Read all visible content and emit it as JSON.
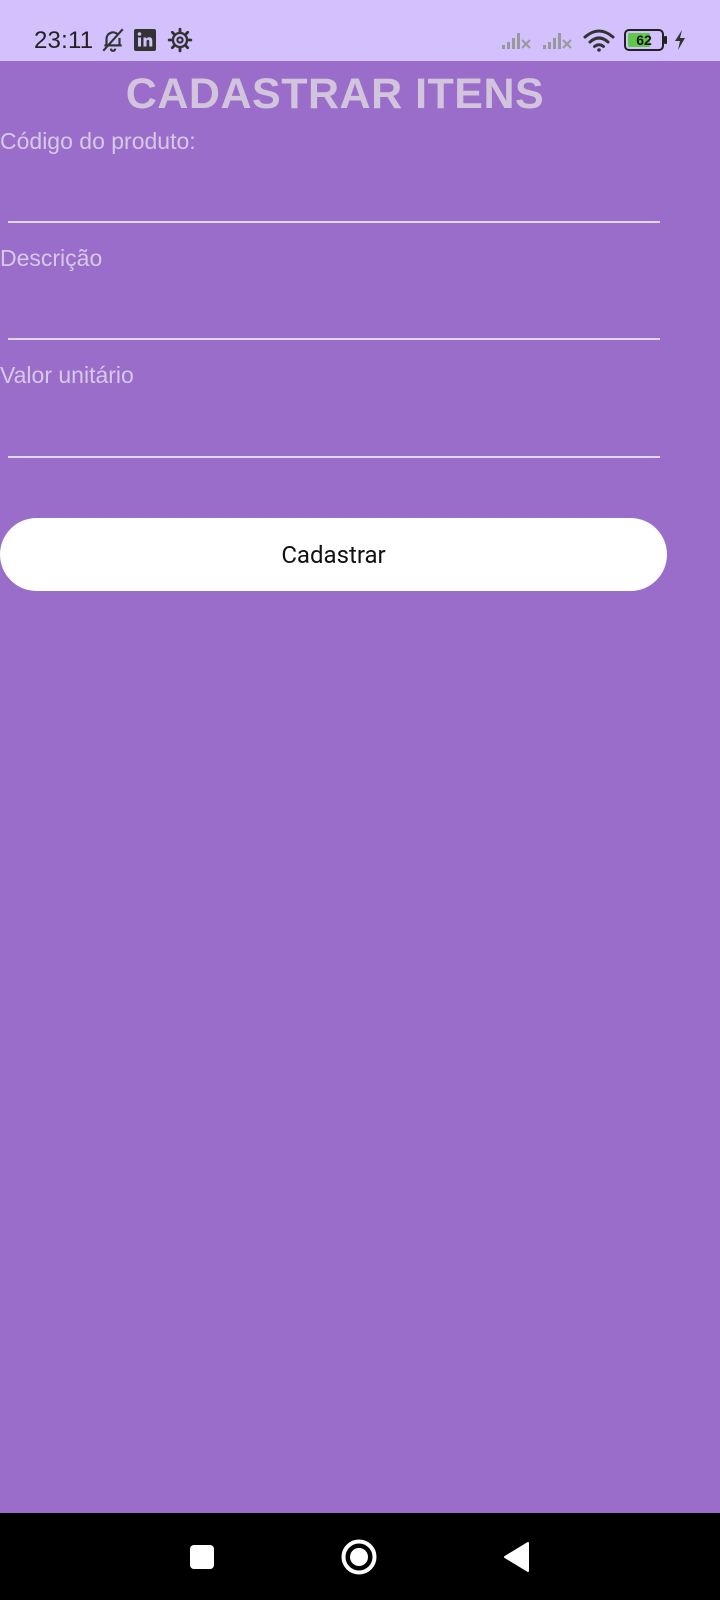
{
  "status_bar": {
    "time": "23:11",
    "battery_level": "62",
    "icons": [
      "notifications-off-icon",
      "linkedin-icon",
      "settings-icon",
      "signal-no-service-icon",
      "signal-no-service-icon",
      "wifi-icon",
      "battery-icon",
      "charging-bolt-icon"
    ]
  },
  "form": {
    "title": "CADASTRAR ITENS",
    "fields": [
      {
        "label": "Código do produto:",
        "value": ""
      },
      {
        "label": "Descrição",
        "value": ""
      },
      {
        "label": "Valor unitário",
        "value": ""
      }
    ],
    "submit_label": "Cadastrar"
  },
  "nav_bar": {
    "buttons": [
      "recents-button",
      "home-button",
      "back-button"
    ]
  },
  "colors": {
    "status_bar_bg": "#d3c1fe",
    "page_bg": "#9a6dca",
    "title_text": "#d2c4dc",
    "label_text": "#d7c9e6",
    "button_bg": "#ffffff",
    "nav_bar_bg": "#000000"
  }
}
